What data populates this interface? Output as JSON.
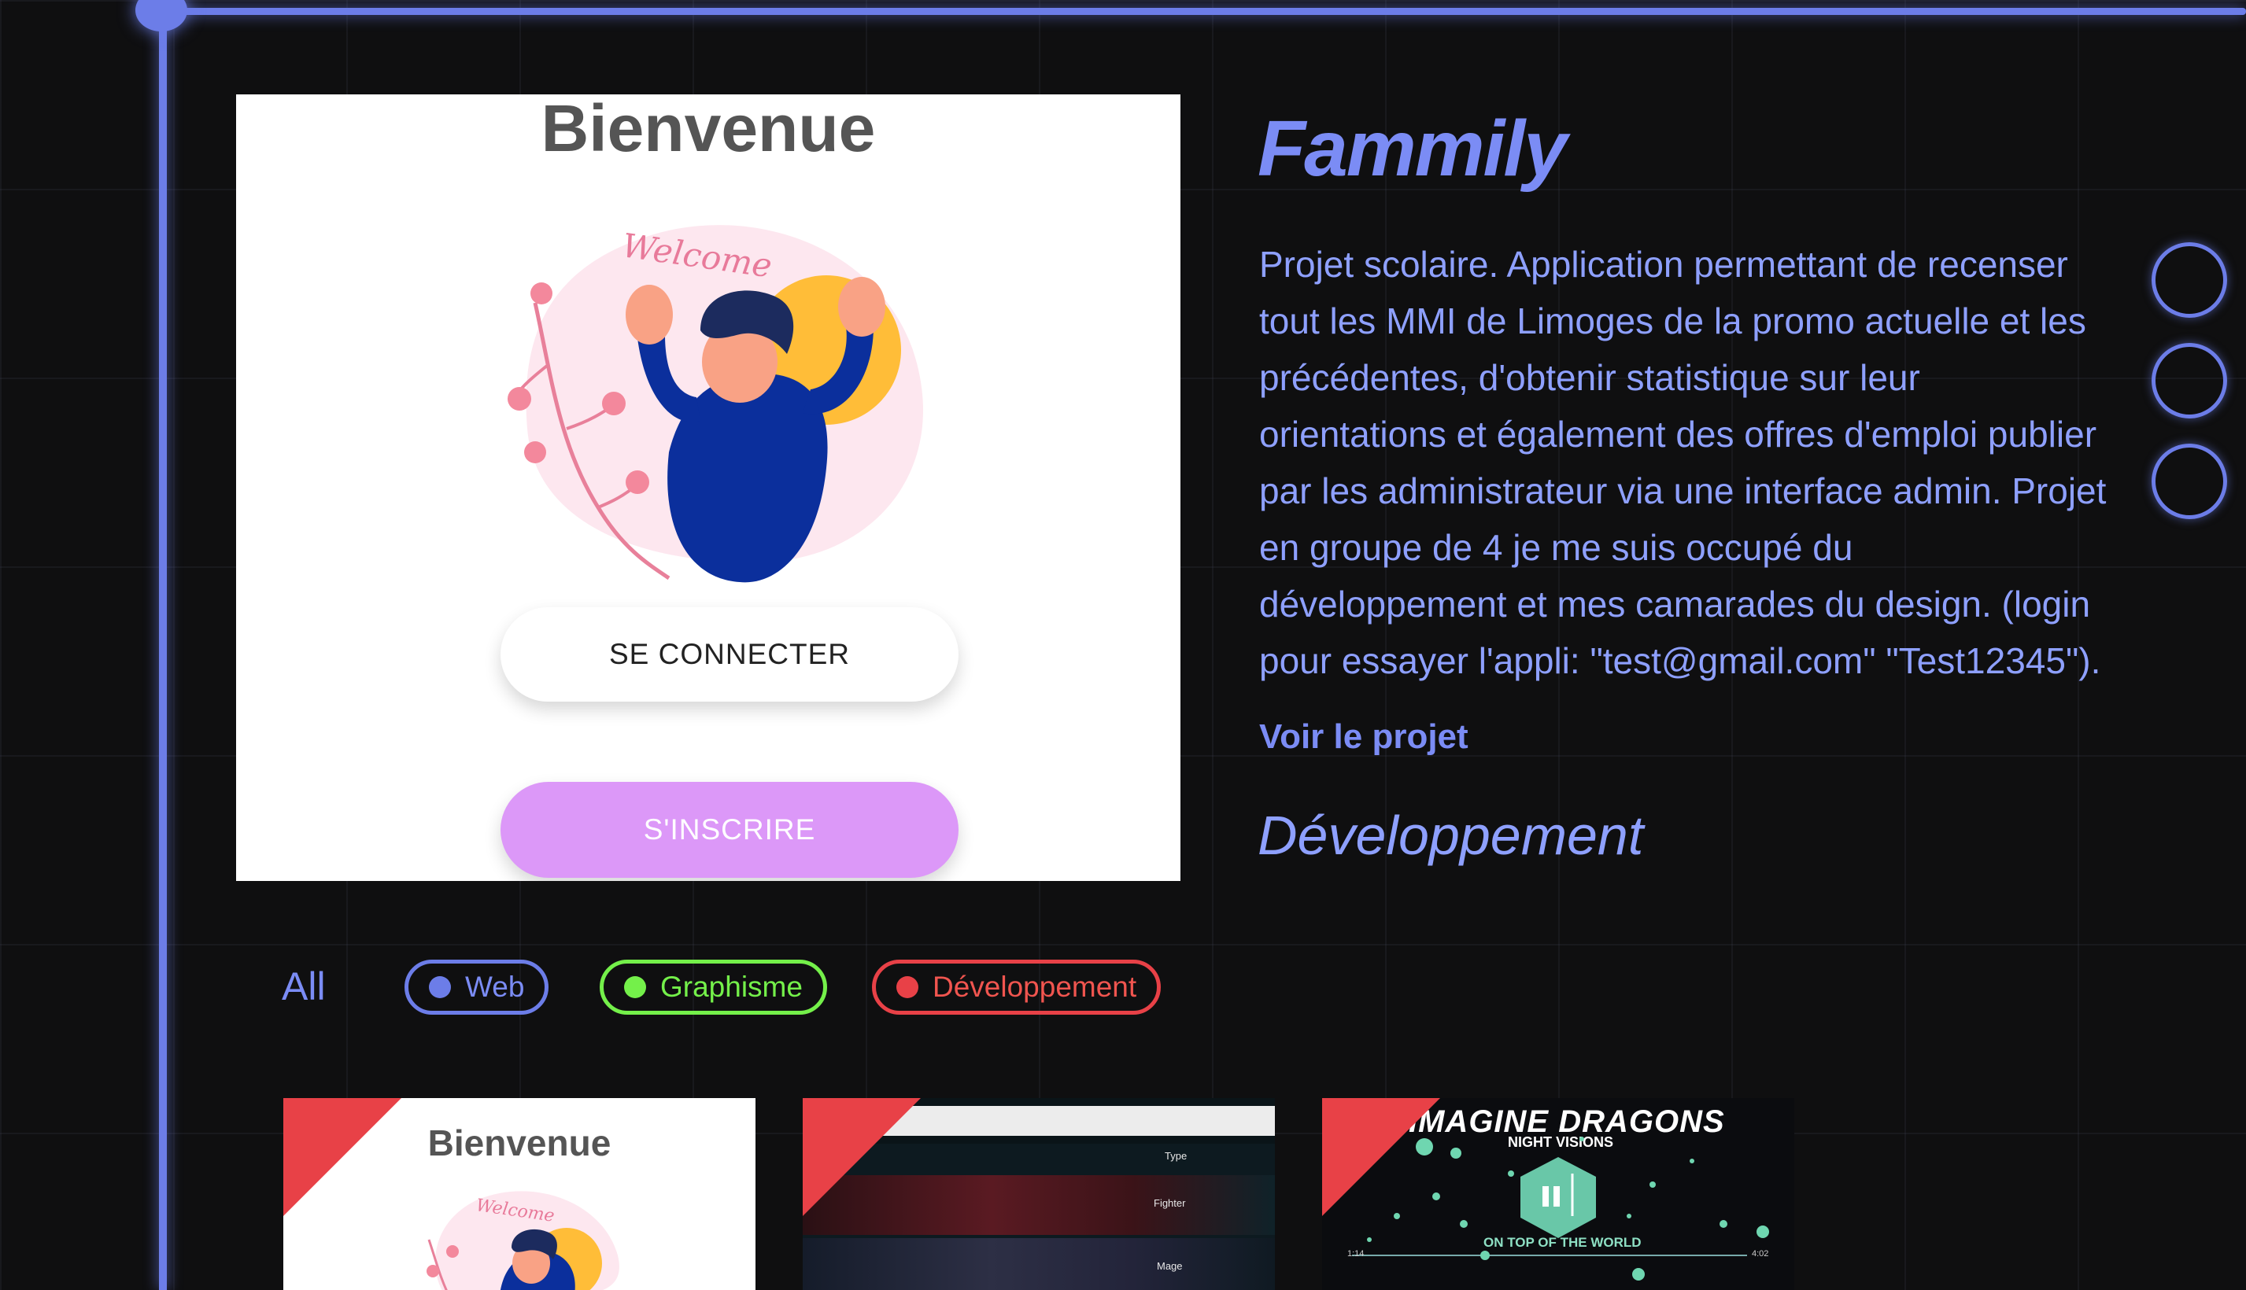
{
  "preview": {
    "title": "Bienvenue",
    "welcome_text": "Welcome",
    "connect_label": "SE CONNECTER",
    "signup_label": "S'INSCRIRE"
  },
  "project": {
    "title": "Fammily",
    "description": "Projet scolaire. Application permettant de recenser tout les MMI de Limoges de la promo actuelle et les précédentes, d'obtenir statistique sur leur orientations et également des offres d'emploi publier par les administrateur via une interface admin. Projet en groupe de 4 je me suis occupé du développement et mes camarades du design. (login pour essayer l'appli: \"test@gmail.com\" \"Test12345\").",
    "link_label": "Voir le projet",
    "category": "Développement"
  },
  "filters": {
    "all": "All",
    "web": "Web",
    "graphisme": "Graphisme",
    "developpement": "Développement"
  },
  "thumbnails": {
    "t1_title": "Bienvenue",
    "t1_welcome": "Welcome",
    "t2_labels": [
      "Type",
      "Fighter",
      "Mage"
    ],
    "t3_band": "IMAGINE DRAGONS",
    "t3_album": "NIGHT VISIONS",
    "t3_song": "ON TOP OF THE WORLD",
    "t3_time_start": "1:14",
    "t3_time_end": "4:02"
  },
  "colors": {
    "accent": "#6c7de8",
    "web": "#6c7de8",
    "graphisme": "#74f04a",
    "developpement": "#e84147",
    "signup": "#dc98f8"
  }
}
